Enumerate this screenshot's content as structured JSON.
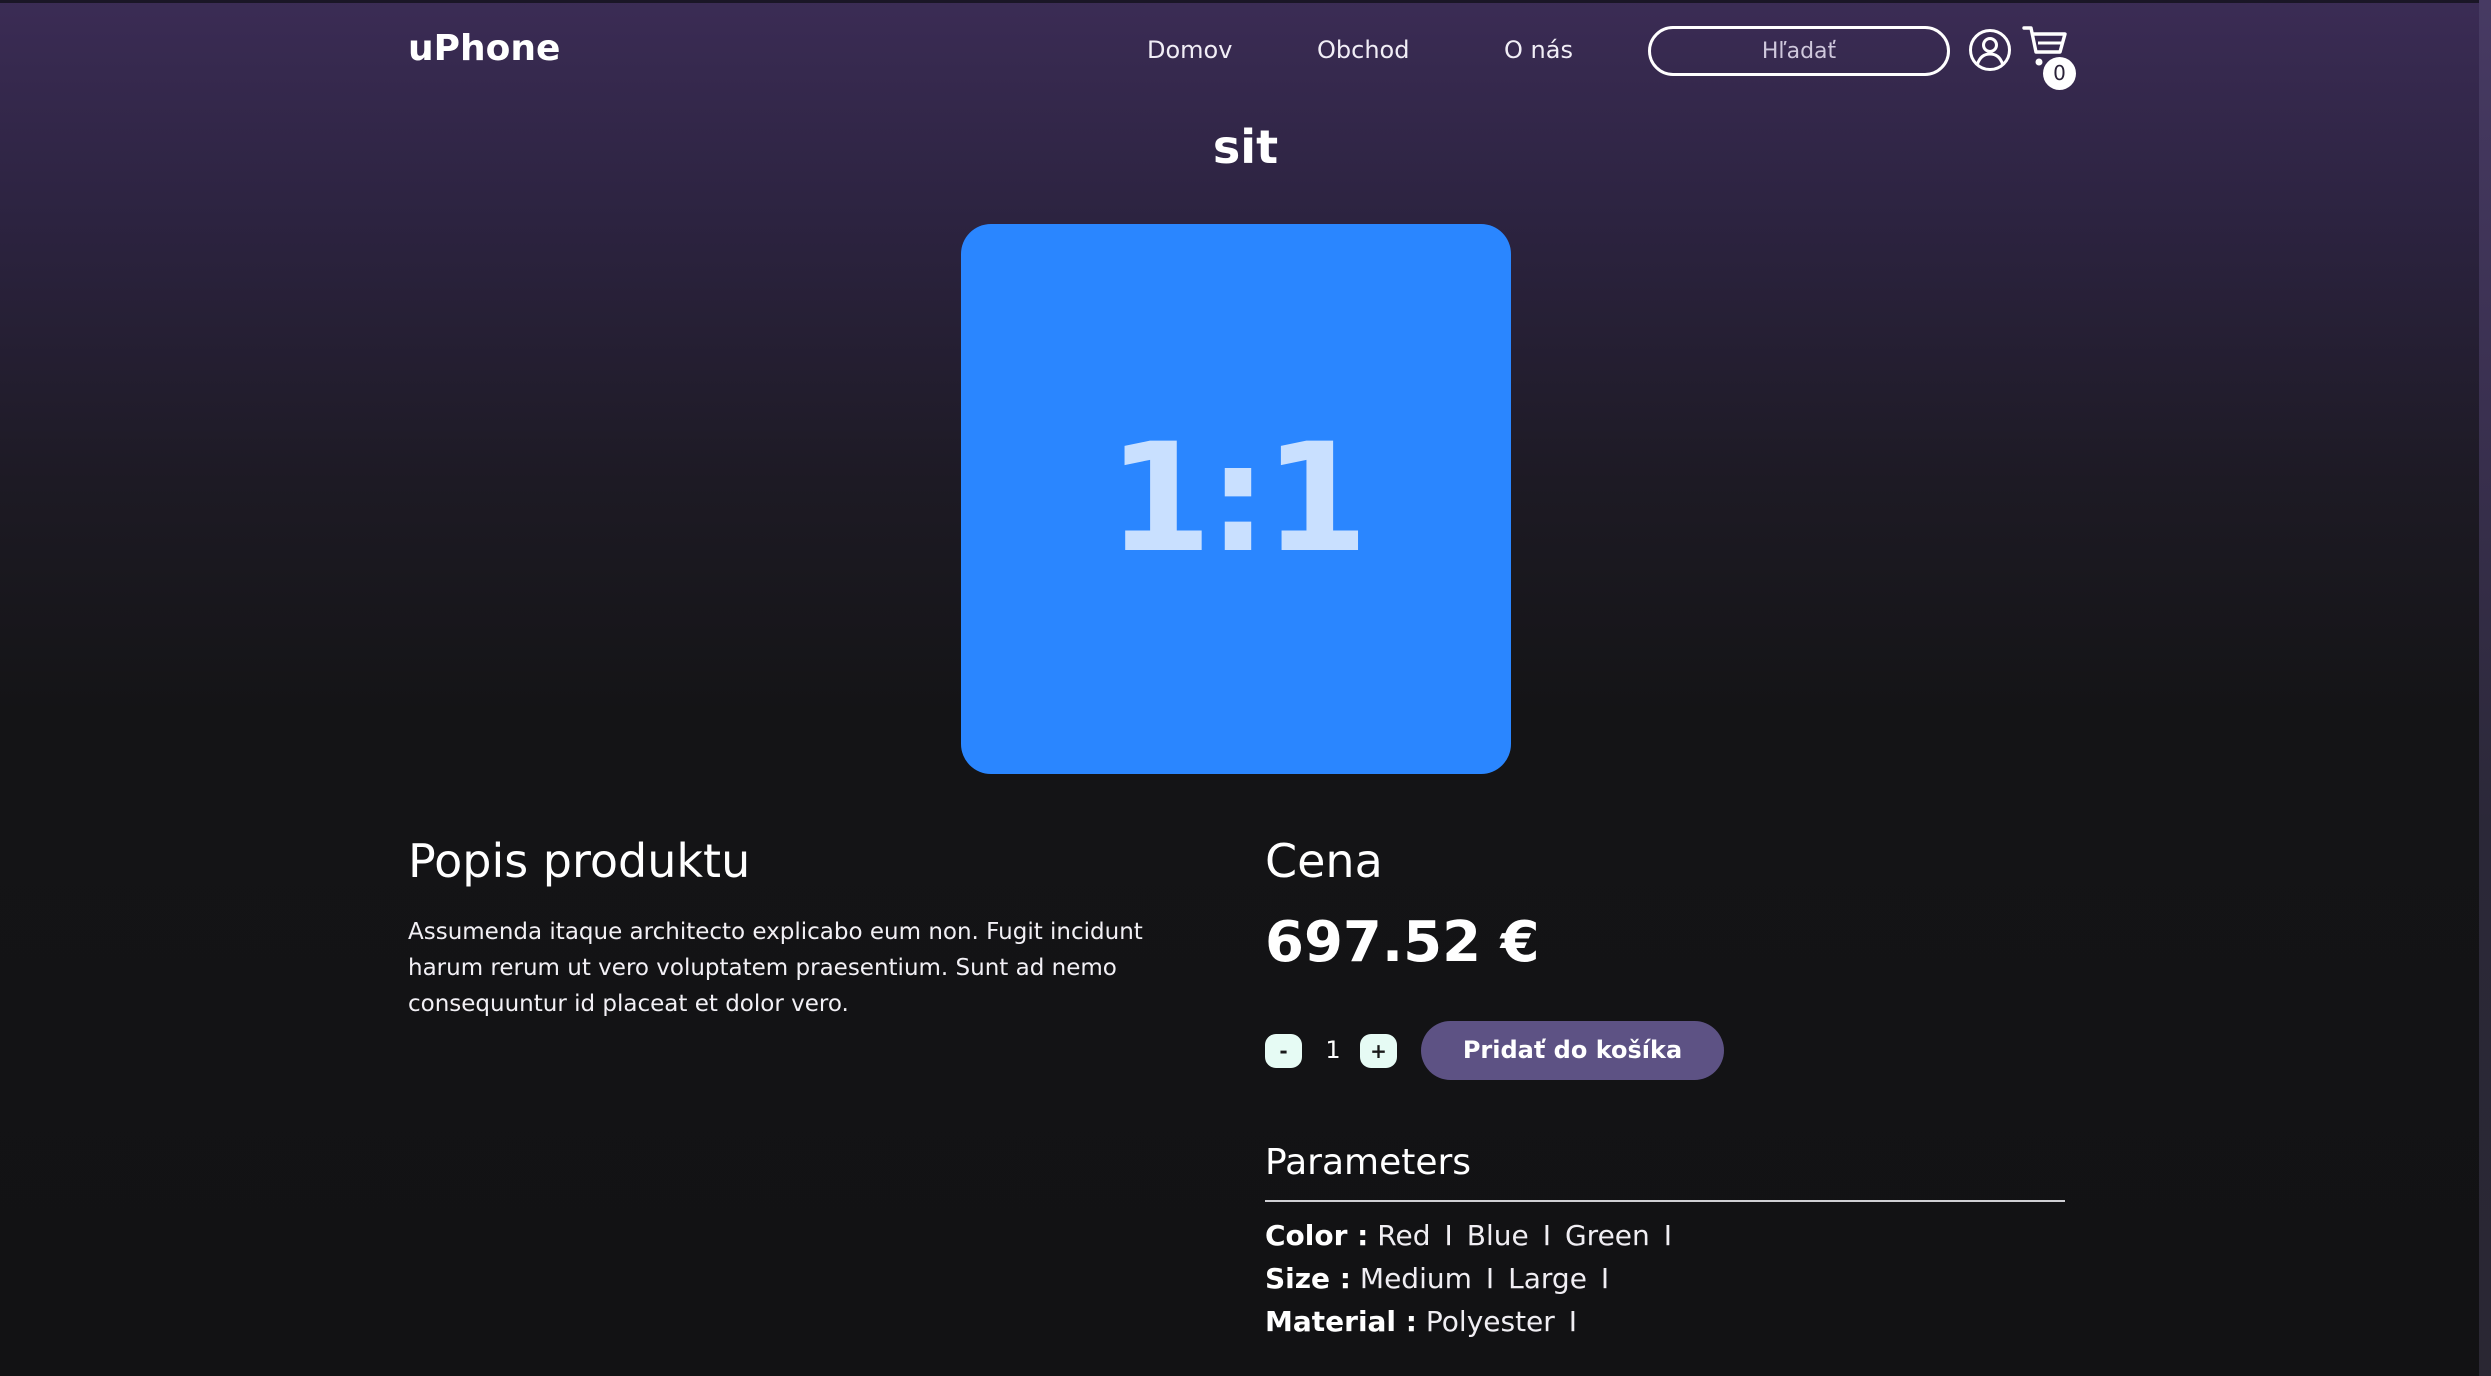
{
  "header": {
    "logo": "uPhone",
    "nav": {
      "home": "Domov",
      "shop": "Obchod",
      "about": "O nás"
    },
    "search": {
      "placeholder": "Hľadať",
      "value": ""
    },
    "user_icon": "user-circle-icon",
    "cart": {
      "icon": "cart-icon",
      "count": "0"
    }
  },
  "product": {
    "title": "sit",
    "image_label": "1:1",
    "image_color": "#2a86ff",
    "description_heading": "Popis produktu",
    "description": "Assumenda itaque architecto explicabo eum non. Fugit incidunt harum rerum ut vero voluptatem praesentium. Sunt ad nemo consequuntur id placeat et dolor vero.",
    "price_heading": "Cena",
    "price": "697.52 €",
    "quantity": {
      "minus": "-",
      "value": "1",
      "plus": "+"
    },
    "add_to_cart": "Pridať do košíka"
  },
  "parameters": {
    "heading": "Parameters",
    "color": {
      "name": "Color :",
      "options": [
        "Red",
        "Blue",
        "Green"
      ]
    },
    "size": {
      "name": "Size :",
      "options": [
        "Medium",
        "Large"
      ]
    },
    "material": {
      "name": "Material :",
      "options": [
        "Polyester"
      ]
    },
    "separator": "I"
  },
  "colors": {
    "accent_button": "#5d5284",
    "qty_button": "#e6fbf4"
  }
}
